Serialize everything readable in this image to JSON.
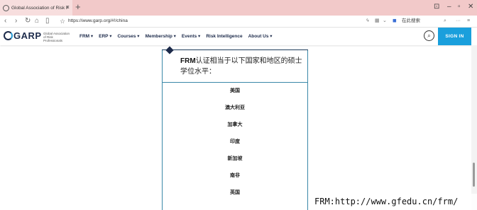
{
  "browser": {
    "tab_title": "Global Association of Risk Profe",
    "tab_close": "×",
    "new_tab": "+",
    "url": "https://www.garp.org/#!/china",
    "search_placeholder": "在此搜索",
    "icons": {
      "back": "back-arrow-icon",
      "forward": "forward-arrow-icon",
      "reload": "reload-icon",
      "home": "home-icon",
      "reading": "reading-view-icon",
      "favorite": "star-icon"
    }
  },
  "site": {
    "logo_text": "GARP",
    "logo_sub": "Global Association of Risk Professionals",
    "menu": [
      "FRM ▾",
      "ERP ▾",
      "Courses ▾",
      "Membership ▾",
      "Events ▾",
      "Risk Intelligence",
      "About Us ▾"
    ],
    "signin": "SIGN IN",
    "accent": "#1a9fdc",
    "brand": "#1c2a4a"
  },
  "content": {
    "title_prefix": "FRM",
    "title_rest": "认证相当于以下国家和地区的硕士学位水平：",
    "countries": [
      "美国",
      "澳大利亚",
      "加拿大",
      "印度",
      "新加坡",
      "南非",
      "英国"
    ]
  },
  "watermark": "FRM:http://www.gfedu.cn/frm/"
}
